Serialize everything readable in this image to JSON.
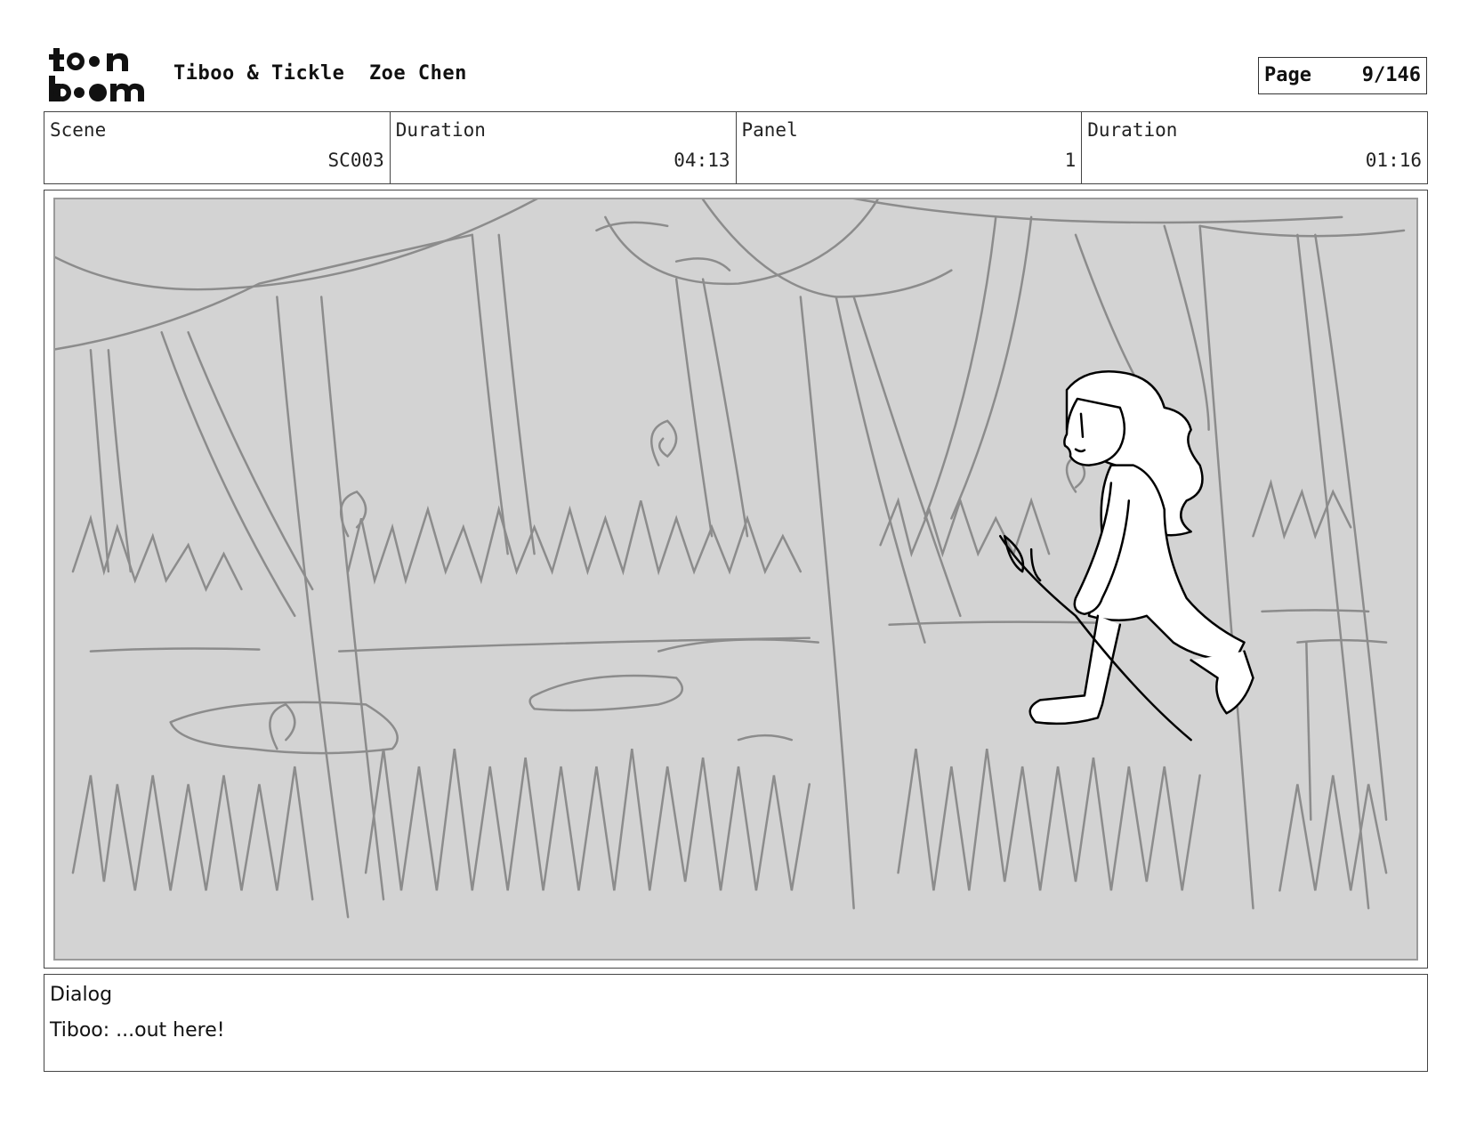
{
  "header": {
    "logo_text": "toon boom",
    "project_title": "Tiboo & Tickle",
    "author": "Zoe Chen",
    "page_label": "Page",
    "page_value": "9/146"
  },
  "info": {
    "scene_label": "Scene",
    "scene_value": "SC003",
    "scene_duration_label": "Duration",
    "scene_duration_value": "04:13",
    "panel_label": "Panel",
    "panel_value": "1",
    "panel_duration_label": "Duration",
    "panel_duration_value": "01:16"
  },
  "panel": {
    "background_color": "#d3d3d3",
    "sketch_color": "#8c8c8c",
    "character_line_color": "#000000"
  },
  "dialog": {
    "label": "Dialog",
    "text": "Tiboo: ...out here!"
  }
}
